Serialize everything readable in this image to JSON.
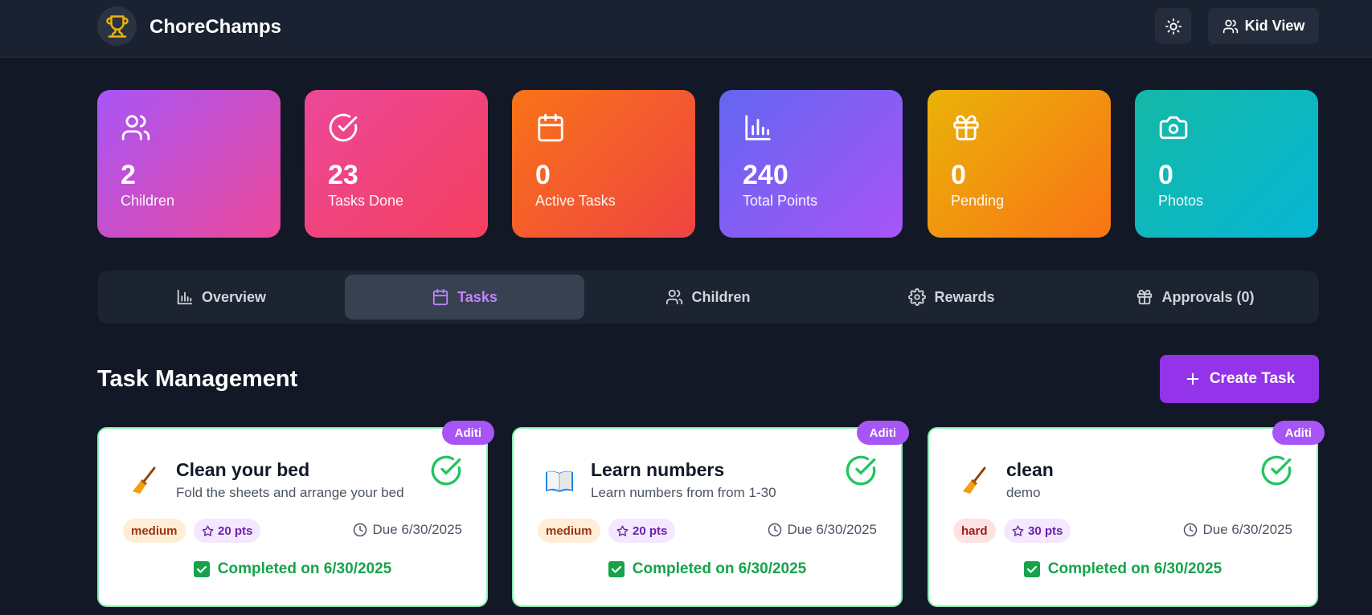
{
  "header": {
    "brand": "ChoreChamps",
    "kid_view_label": "Kid View"
  },
  "stats": [
    {
      "value": "2",
      "label": "Children",
      "icon": "users-icon"
    },
    {
      "value": "23",
      "label": "Tasks Done",
      "icon": "check-circle-icon"
    },
    {
      "value": "0",
      "label": "Active Tasks",
      "icon": "calendar-icon"
    },
    {
      "value": "240",
      "label": "Total Points",
      "icon": "bar-chart-icon"
    },
    {
      "value": "0",
      "label": "Pending",
      "icon": "gift-icon"
    },
    {
      "value": "0",
      "label": "Photos",
      "icon": "camera-icon"
    }
  ],
  "tabs": [
    {
      "label": "Overview",
      "icon": "bar-chart-icon"
    },
    {
      "label": "Tasks",
      "icon": "calendar-icon",
      "active": true
    },
    {
      "label": "Children",
      "icon": "users-icon"
    },
    {
      "label": "Rewards",
      "icon": "gear-icon"
    },
    {
      "label": "Approvals (0)",
      "icon": "gift-icon"
    }
  ],
  "section": {
    "title": "Task Management",
    "create_label": "Create Task"
  },
  "colors": {
    "accent": "#9333ea",
    "success": "#16a34a",
    "background": "#121826"
  },
  "tasks": [
    {
      "assignee": "Aditi",
      "emoji": "broom",
      "title": "Clean your bed",
      "description": "Fold the sheets and arrange your bed",
      "difficulty": "medium",
      "points": "20 pts",
      "due": "Due 6/30/2025",
      "completed": "Completed on 6/30/2025"
    },
    {
      "assignee": "Aditi",
      "emoji": "book",
      "title": "Learn numbers",
      "description": "Learn numbers from from 1-30",
      "difficulty": "medium",
      "points": "20 pts",
      "due": "Due 6/30/2025",
      "completed": "Completed on 6/30/2025"
    },
    {
      "assignee": "Aditi",
      "emoji": "broom",
      "title": "clean",
      "description": "demo",
      "difficulty": "hard",
      "points": "30 pts",
      "due": "Due 6/30/2025",
      "completed": "Completed on 6/30/2025"
    }
  ]
}
